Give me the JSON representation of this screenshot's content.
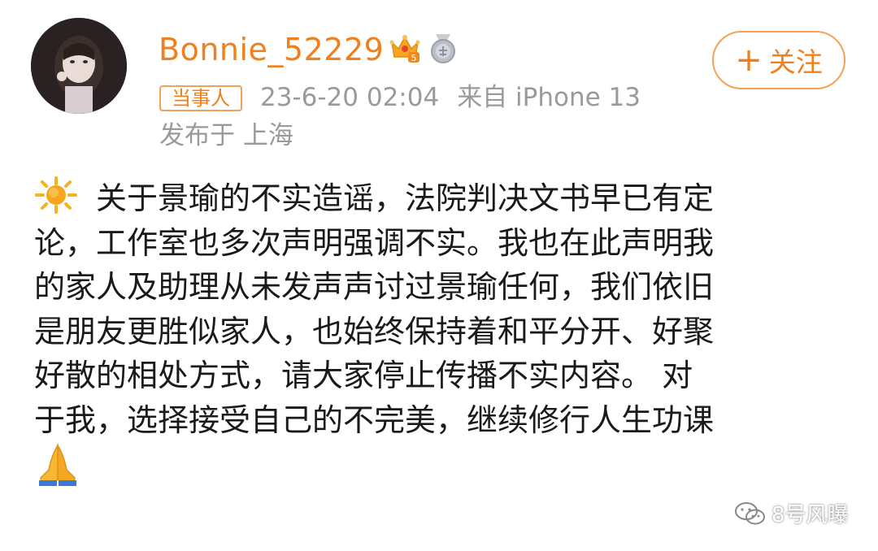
{
  "post_header": {
    "username": "Bonnie_52229",
    "crown_badge_level": "5",
    "follow_button": {
      "plus": "+",
      "label": "关注"
    },
    "tag": "当事人",
    "timestamp": "23-6-20 02:04",
    "source": "来自 iPhone 13",
    "location": "发布于 上海"
  },
  "post_body": {
    "lines": [
      "关于景瑜的不实造谣，法院判决文书早已有定",
      "论，工作室也多次声明强调不实。我也在此声明我",
      "的家人及助理从未发声声讨过景瑜任何，我们依旧",
      "是朋友更胜似家人，也始终保持着和平分开、好聚",
      "好散的相处方式，请大家停止传播不实内容。 对",
      "于我，选择接受自己的不完美，继续修行人生功课"
    ],
    "leading_emoji": "sun-icon",
    "trailing_emoji": "pray-icon"
  },
  "watermark": {
    "text": "8号风曝",
    "icon": "wechat-icon"
  },
  "colors": {
    "accent": "#f0801d",
    "meta_gray": "#9a9a9a",
    "body_text": "#1a1a1a"
  }
}
